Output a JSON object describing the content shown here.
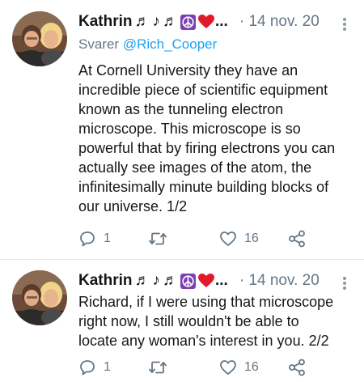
{
  "tweets": [
    {
      "author_name": "Kathrin",
      "name_emojis": [
        "♬",
        "♪",
        "♬"
      ],
      "name_ellipsis": "...",
      "timestamp": "· 14 nov. 20",
      "reply_prefix": "Svarer",
      "reply_handle": "@Rich_Cooper",
      "text": "At Cornell University they have an\nincredible piece of scientific equipment\nknown as the tunneling electron\nmicroscope. This microscope is so\npowerful that by firing electrons you can\nactually see images of the atom, the\ninfinitesimally minute building blocks of\nour universe. 1/2",
      "reply_count": "1",
      "retweet_count": "",
      "like_count": "16"
    },
    {
      "author_name": "Kathrin",
      "name_emojis": [
        "♬",
        "♪",
        "♬"
      ],
      "name_ellipsis": "...",
      "timestamp": "· 14 nov. 20",
      "text": "Richard, if I were using that microscope\nright now, I still wouldn't be able to\nlocate any woman's interest in you. 2/2",
      "reply_count": "1",
      "retweet_count": "",
      "like_count": "16"
    }
  ],
  "colors": {
    "text": "#14171a",
    "muted": "#657786",
    "link": "#1da1f2",
    "divider": "#e1e8ed",
    "heart": "#e0192b",
    "peace_bg": "#7b3fb3"
  }
}
